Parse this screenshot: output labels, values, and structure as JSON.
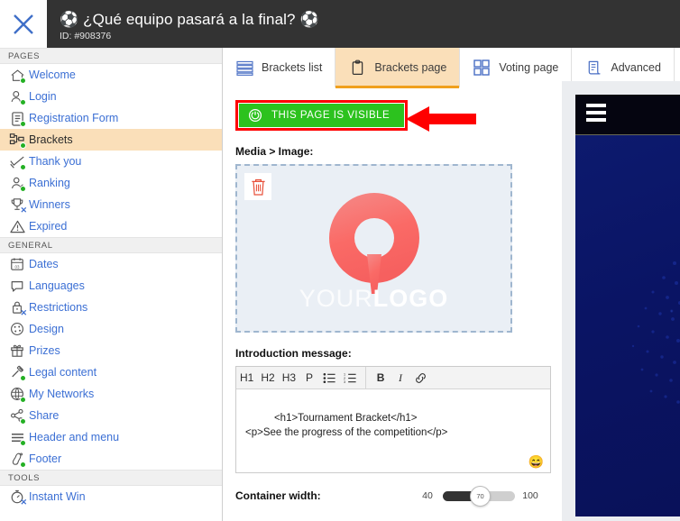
{
  "header": {
    "close_icon": "close-x-icon",
    "ball_icon": "soccer-ball-icon",
    "title": "¿Qué equipo pasará a la final?",
    "id_label": "ID: #908376"
  },
  "sidebar": {
    "sections": [
      {
        "label": "PAGES",
        "items": [
          {
            "label": "Welcome",
            "icon": "home-icon",
            "badge": "dot",
            "active": false
          },
          {
            "label": "Login",
            "icon": "user-login-icon",
            "badge": "dot",
            "active": false
          },
          {
            "label": "Registration Form",
            "icon": "form-icon",
            "badge": "dot",
            "active": false
          },
          {
            "label": "Brackets",
            "icon": "brackets-icon",
            "badge": "dot",
            "active": true
          },
          {
            "label": "Thank you",
            "icon": "check-heart-icon",
            "badge": "dot",
            "active": false
          },
          {
            "label": "Ranking",
            "icon": "ranking-icon",
            "badge": "dot",
            "active": false
          },
          {
            "label": "Winners",
            "icon": "trophy-icon",
            "badge": "x",
            "active": false
          },
          {
            "label": "Expired",
            "icon": "warning-icon",
            "badge": "none",
            "active": false
          }
        ]
      },
      {
        "label": "GENERAL",
        "items": [
          {
            "label": "Dates",
            "icon": "calendar-icon",
            "badge": "none",
            "active": false
          },
          {
            "label": "Languages",
            "icon": "speech-icon",
            "badge": "none",
            "active": false
          },
          {
            "label": "Restrictions",
            "icon": "lock-icon",
            "badge": "x",
            "active": false
          },
          {
            "label": "Design",
            "icon": "palette-icon",
            "badge": "none",
            "active": false
          },
          {
            "label": "Prizes",
            "icon": "gift-icon",
            "badge": "none",
            "active": false
          },
          {
            "label": "Legal content",
            "icon": "gavel-icon",
            "badge": "dot",
            "active": false
          },
          {
            "label": "My Networks",
            "icon": "network-icon",
            "badge": "dot",
            "active": false
          },
          {
            "label": "Share",
            "icon": "share-icon",
            "badge": "dot",
            "active": false
          },
          {
            "label": "Header and menu",
            "icon": "menu-lines-icon",
            "badge": "dot",
            "active": false
          },
          {
            "label": "Footer",
            "icon": "footprint-icon",
            "badge": "dot",
            "active": false
          }
        ]
      },
      {
        "label": "TOOLS",
        "items": [
          {
            "label": "Instant Win",
            "icon": "stopwatch-icon",
            "badge": "x",
            "active": false
          }
        ]
      }
    ]
  },
  "tabs": [
    {
      "label": "Brackets list",
      "icon": "list-rows-icon",
      "active": false
    },
    {
      "label": "Brackets page",
      "icon": "clipboard-icon",
      "active": true
    },
    {
      "label": "Voting page",
      "icon": "grid-icon",
      "active": false
    },
    {
      "label": "Advanced",
      "icon": "scroll-icon",
      "active": false
    }
  ],
  "content": {
    "visibility_button": {
      "label": "THIS PAGE IS VISIBLE",
      "icon": "power-toggle-icon",
      "highlighted": true
    },
    "annotation_arrow": "red-left-arrow",
    "media_label": "Media > Image:",
    "dropzone": {
      "delete_icon": "trash-icon",
      "logo_placeholder_light": "YOUR",
      "logo_placeholder_bold": "LOGO"
    },
    "intro_label": "Introduction message:",
    "editor_toolbar": [
      {
        "label": "H1",
        "name": "heading-1-button"
      },
      {
        "label": "H2",
        "name": "heading-2-button"
      },
      {
        "label": "H3",
        "name": "heading-3-button"
      },
      {
        "label": "P",
        "name": "paragraph-button"
      },
      {
        "label": "",
        "name": "bullet-list-icon"
      },
      {
        "label": "",
        "name": "numbered-list-icon"
      },
      {
        "label": "B",
        "name": "bold-button"
      },
      {
        "label": "I",
        "name": "italic-button"
      },
      {
        "label": "",
        "name": "link-icon"
      }
    ],
    "editor_value": "<h1>Tournament Bracket</h1>\n<p>See the progress of the competition</p>",
    "emoji_button": "😄",
    "container_width": {
      "label": "Container width:",
      "min": "40",
      "value": "70",
      "max": "100"
    }
  },
  "preview": {
    "menu_icon": "hamburger-menu-icon"
  },
  "colors": {
    "accent_orange": "#fadfb9",
    "tab_underline": "#f0a01e",
    "link_blue": "#3b6fd4",
    "visible_green": "#2cc21e",
    "highlight_red": "#ff0000",
    "status_green": "#24b024",
    "header_dark": "#333333",
    "preview_navy": "#0a1464"
  }
}
